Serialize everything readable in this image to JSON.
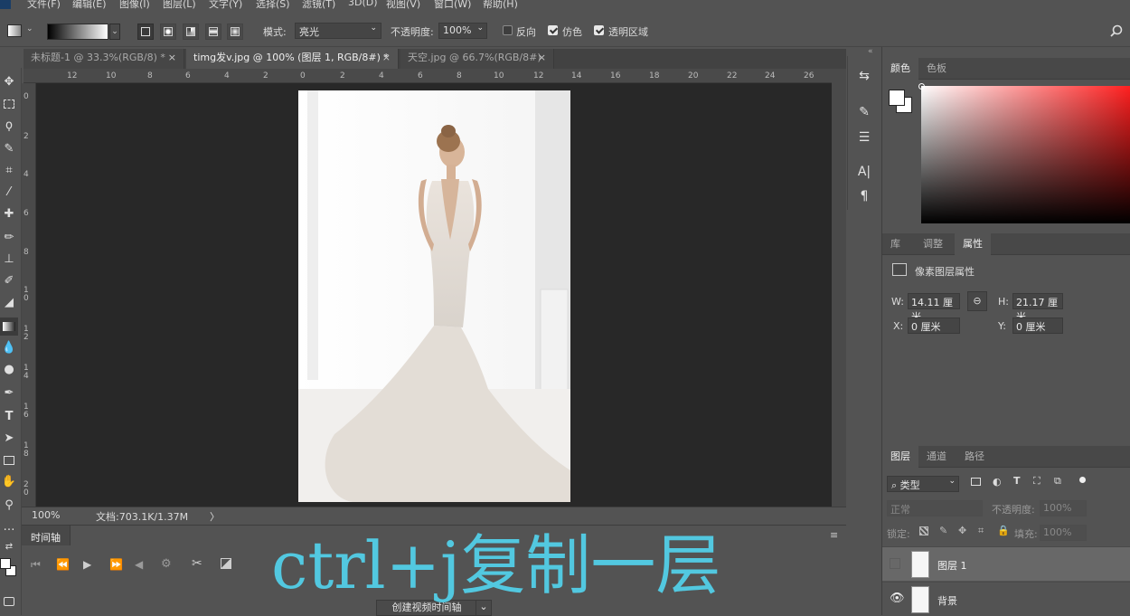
{
  "menubar": {
    "items": [
      "文件(F)",
      "编辑(E)",
      "图像(I)",
      "图层(L)",
      "文字(Y)",
      "选择(S)",
      "滤镜(T)",
      "3D(D)",
      "视图(V)",
      "窗口(W)",
      "帮助(H)"
    ]
  },
  "options": {
    "mode_label": "模式:",
    "mode_value": "亮光",
    "opacity_label": "不透明度:",
    "opacity_value": "100%",
    "reverse_label": "反向",
    "dither_label": "仿色",
    "transparency_label": "透明区域",
    "reverse_checked": false,
    "dither_checked": true,
    "transparency_checked": true
  },
  "tabs": [
    {
      "label": "未标题-1 @ 33.3%(RGB/8) *",
      "close": "×",
      "active": false
    },
    {
      "label": "timg发v.jpg @ 100% (图层 1, RGB/8#) *",
      "close": "×",
      "active": true
    },
    {
      "label": "天空.jpg @ 66.7%(RGB/8#)",
      "close": "×",
      "active": false
    }
  ],
  "ruler": {
    "h_labels": [
      "12",
      "10",
      "8",
      "6",
      "4",
      "2",
      "0",
      "2",
      "4",
      "6",
      "8",
      "10",
      "12",
      "14",
      "16",
      "18",
      "20",
      "22",
      "24",
      "26"
    ],
    "v_labels": [
      "0",
      "2",
      "4",
      "6",
      "8",
      "1 0",
      "1 2",
      "1 4",
      "1 6",
      "1 8",
      "2 0"
    ]
  },
  "status": {
    "zoom": "100%",
    "doc_label": "文档:703.1K/1.37M",
    "arrow": "〉"
  },
  "timeline": {
    "title": "时间轴",
    "create_button": "创建视频时间轴",
    "dropdown_icon": "⌄"
  },
  "caption": "ctrl+j复制一层",
  "color_panel": {
    "tabs": [
      "颜色",
      "色板"
    ],
    "active": "颜色",
    "picker_hue": "#ff1f1f"
  },
  "properties_panel": {
    "tabs": [
      "库",
      "调整",
      "属性"
    ],
    "active": "属性",
    "title": "像素图层属性",
    "w_label": "W:",
    "w_value": "14.11 厘米",
    "h_label": "H:",
    "h_value": "21.17 厘米",
    "x_label": "X:",
    "x_value": "0 厘米",
    "y_label": "Y:",
    "y_value": "0 厘米"
  },
  "layers_panel": {
    "tabs": [
      "图层",
      "通道",
      "路径"
    ],
    "active": "图层",
    "filter_label": "类型",
    "blend_mode": "正常",
    "opacity_label": "不透明度:",
    "opacity_value": "100%",
    "lock_label": "锁定:",
    "fill_label": "填充:",
    "fill_value": "100%",
    "layers": [
      {
        "name": "图层 1",
        "visible": false,
        "selected": true
      },
      {
        "name": "背景",
        "visible": true,
        "selected": false
      }
    ]
  },
  "colors": {
    "accent": "#52c8e0",
    "canvas_bg": "#282828",
    "panel_bg": "#535353"
  }
}
